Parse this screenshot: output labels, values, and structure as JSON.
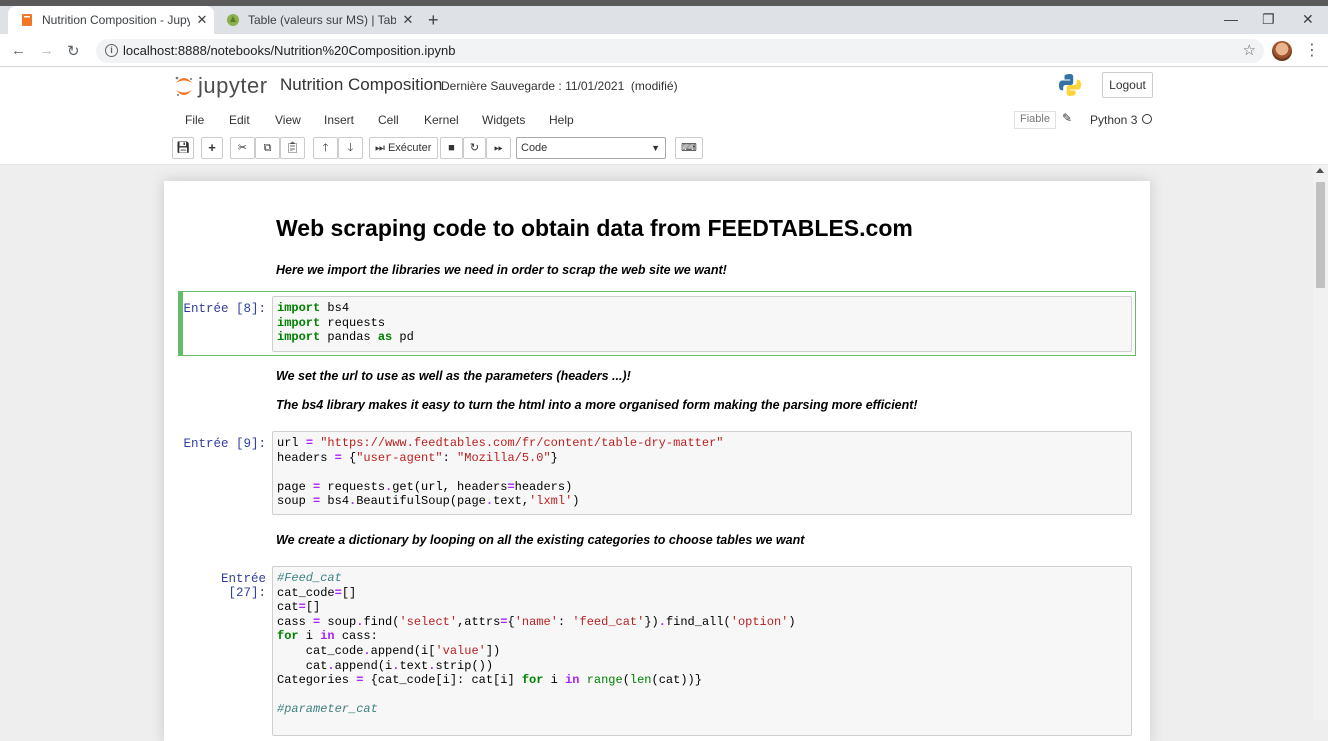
{
  "browser": {
    "tabs": [
      {
        "title": "Nutrition Composition - Jupyter",
        "active": true
      },
      {
        "title": "Table (valeurs sur MS) | Tables de",
        "active": false
      }
    ],
    "new_tab": "+",
    "window_controls": {
      "minimize": "—",
      "restore": "❐",
      "close": "✕"
    },
    "url": "localhost:8888/notebooks/Nutrition%20Composition.ipynb"
  },
  "jupyter": {
    "logo_text": "jupyter",
    "notebook_name": "Nutrition Composition",
    "save_status": "Dernière Sauvegarde : 11/01/2021",
    "modified": "(modifié)",
    "logout": "Logout",
    "menu": [
      "File",
      "Edit",
      "View",
      "Insert",
      "Cell",
      "Kernel",
      "Widgets",
      "Help"
    ],
    "trusted": "Fiable",
    "kernel": "Python 3",
    "toolbar": {
      "run_label": "Exécuter",
      "cell_type": "Code"
    }
  },
  "notebook": {
    "heading": "Web scraping code to obtain data from FEEDTABLES.com",
    "md1": "Here we import the libraries we need in order to scrap the web site we want!",
    "md2": "We set the url to use as well as the parameters (headers ...)!",
    "md3": "The bs4 library makes it easy to turn the html into a more organised form making the parsing more efficient!",
    "md4": "We create a dictionary by looping on all the existing categories to choose tables we want",
    "cells": [
      {
        "prompt": "Entrée [8]:"
      },
      {
        "prompt": "Entrée [9]:"
      },
      {
        "prompt": "Entrée [27]:"
      }
    ]
  }
}
